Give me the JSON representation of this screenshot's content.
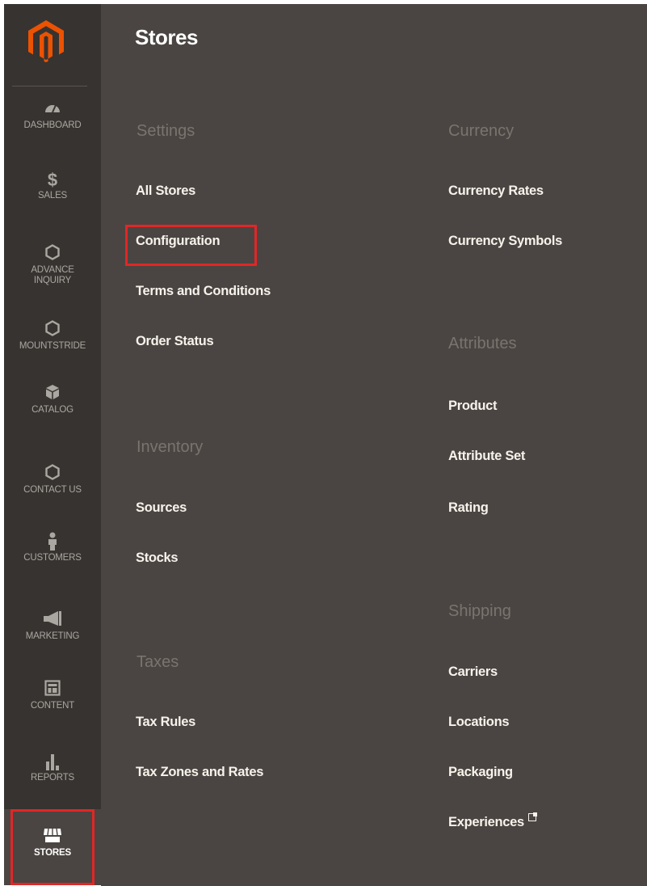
{
  "colors": {
    "sidebar_bg": "#373330",
    "panel_bg": "#4a4542",
    "logo_orange": "#eb5202",
    "highlight_red": "#e22626",
    "section_title": "#7a746e",
    "link_text": "#f7f3eb"
  },
  "sidebar": {
    "items": [
      {
        "label": "DASHBOARD",
        "icon": "dashboard-icon",
        "glyph": "◒"
      },
      {
        "label": "SALES",
        "icon": "dollar-icon",
        "glyph": "$"
      },
      {
        "label": "ADVANCE INQUIRY",
        "icon": "hexagon-icon",
        "glyph": "⬡"
      },
      {
        "label": "MOUNTSTRIDE",
        "icon": "hexagon-icon",
        "glyph": "⬡"
      },
      {
        "label": "CATALOG",
        "icon": "box-icon",
        "glyph": "◈"
      },
      {
        "label": "CONTACT US",
        "icon": "hexagon-icon",
        "glyph": "⬡"
      },
      {
        "label": "CUSTOMERS",
        "icon": "person-icon",
        "glyph": "♟"
      },
      {
        "label": "MARKETING",
        "icon": "megaphone-icon",
        "glyph": "◀"
      },
      {
        "label": "CONTENT",
        "icon": "layout-icon",
        "glyph": "▦"
      },
      {
        "label": "REPORTS",
        "icon": "bar-chart-icon",
        "glyph": "▮"
      },
      {
        "label": "STORES",
        "icon": "storefront-icon",
        "glyph": "⌂"
      }
    ]
  },
  "panel": {
    "title": "Stores",
    "settings": {
      "title": "Settings",
      "links": [
        "All Stores",
        "Configuration",
        "Terms and Conditions",
        "Order Status"
      ]
    },
    "inventory": {
      "title": "Inventory",
      "links": [
        "Sources",
        "Stocks"
      ]
    },
    "taxes": {
      "title": "Taxes",
      "links": [
        "Tax Rules",
        "Tax Zones and Rates"
      ]
    },
    "currency": {
      "title": "Currency",
      "links": [
        "Currency Rates",
        "Currency Symbols"
      ]
    },
    "attributes": {
      "title": "Attributes",
      "links": [
        "Product",
        "Attribute Set",
        "Rating"
      ]
    },
    "shipping": {
      "title": "Shipping",
      "links": [
        "Carriers",
        "Locations",
        "Packaging",
        "Experiences"
      ]
    }
  }
}
